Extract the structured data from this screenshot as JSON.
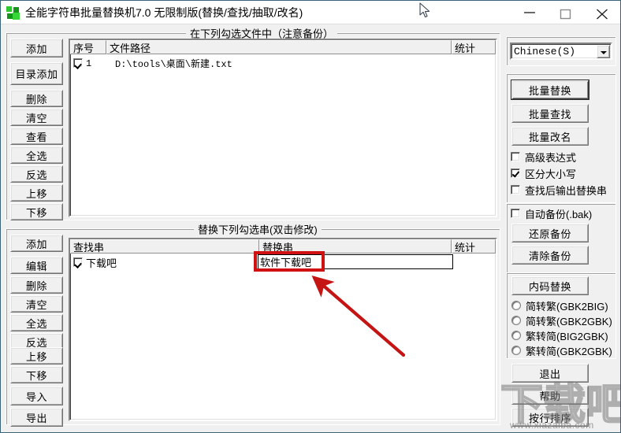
{
  "window": {
    "title": "全能字符串批量替换机7.0 无限制版(替换/查找/抽取/改名)",
    "icon": "app-squares-icon",
    "minimize_label": "—",
    "maximize_label": "□",
    "close_label": "✕"
  },
  "file_panel": {
    "title": "在下列勾选文件中（注意备份）",
    "columns": [
      "序号",
      "文件路径",
      "统计"
    ],
    "rows": [
      {
        "checked": true,
        "index": "1",
        "path": "D:\\tools\\桌面\\新建.txt",
        "count": ""
      }
    ],
    "buttons": [
      "添加",
      "目录添加",
      "删除",
      "清空",
      "查看",
      "全选",
      "反选",
      "上移",
      "下移"
    ]
  },
  "replace_panel": {
    "title": "替换下列勾选串(双击修改)",
    "columns": [
      "查找串",
      "替换串",
      "统计"
    ],
    "rows": [
      {
        "checked": true,
        "find": "下载吧",
        "replace": "",
        "count": ""
      }
    ],
    "editor_value": "软件下载吧",
    "buttons": [
      "添加",
      "编辑",
      "删除",
      "清空",
      "全选",
      "反选",
      "上移",
      "下移",
      "导入",
      "导出"
    ]
  },
  "right_panel": {
    "language": {
      "value": "Chinese(S)",
      "options": [
        "Chinese(S)"
      ]
    },
    "actions": [
      {
        "label": "批量替换",
        "default": true
      },
      {
        "label": "批量查找",
        "default": false
      },
      {
        "label": "批量改名",
        "default": false
      }
    ],
    "options": [
      {
        "label": "高级表达式",
        "checked": false
      },
      {
        "label": "区分大小写",
        "checked": true
      },
      {
        "label": "查找后输出替换串",
        "checked": false
      }
    ],
    "backup": {
      "auto_label": "自动备份(.bak)",
      "auto_checked": false,
      "restore_label": "还原备份",
      "clear_label": "清除备份"
    },
    "encoding": {
      "button_label": "内码替换",
      "radios": [
        {
          "label": "简转繁(GBK2BIG)",
          "checked": false
        },
        {
          "label": "简转繁(GBK2GBK)",
          "checked": false
        },
        {
          "label": "繁转简(BIG2GBK)",
          "checked": false
        },
        {
          "label": "繁转简(GBK2GBK)",
          "checked": false
        }
      ]
    },
    "footer": [
      "退出",
      "帮助",
      "按行排序"
    ]
  },
  "annotation": {
    "highlight_color": "#cf1111",
    "arrow_color": "#cc1111"
  },
  "watermark": {
    "chars": "下载吧",
    "url": "www.xiazaiba.com"
  }
}
